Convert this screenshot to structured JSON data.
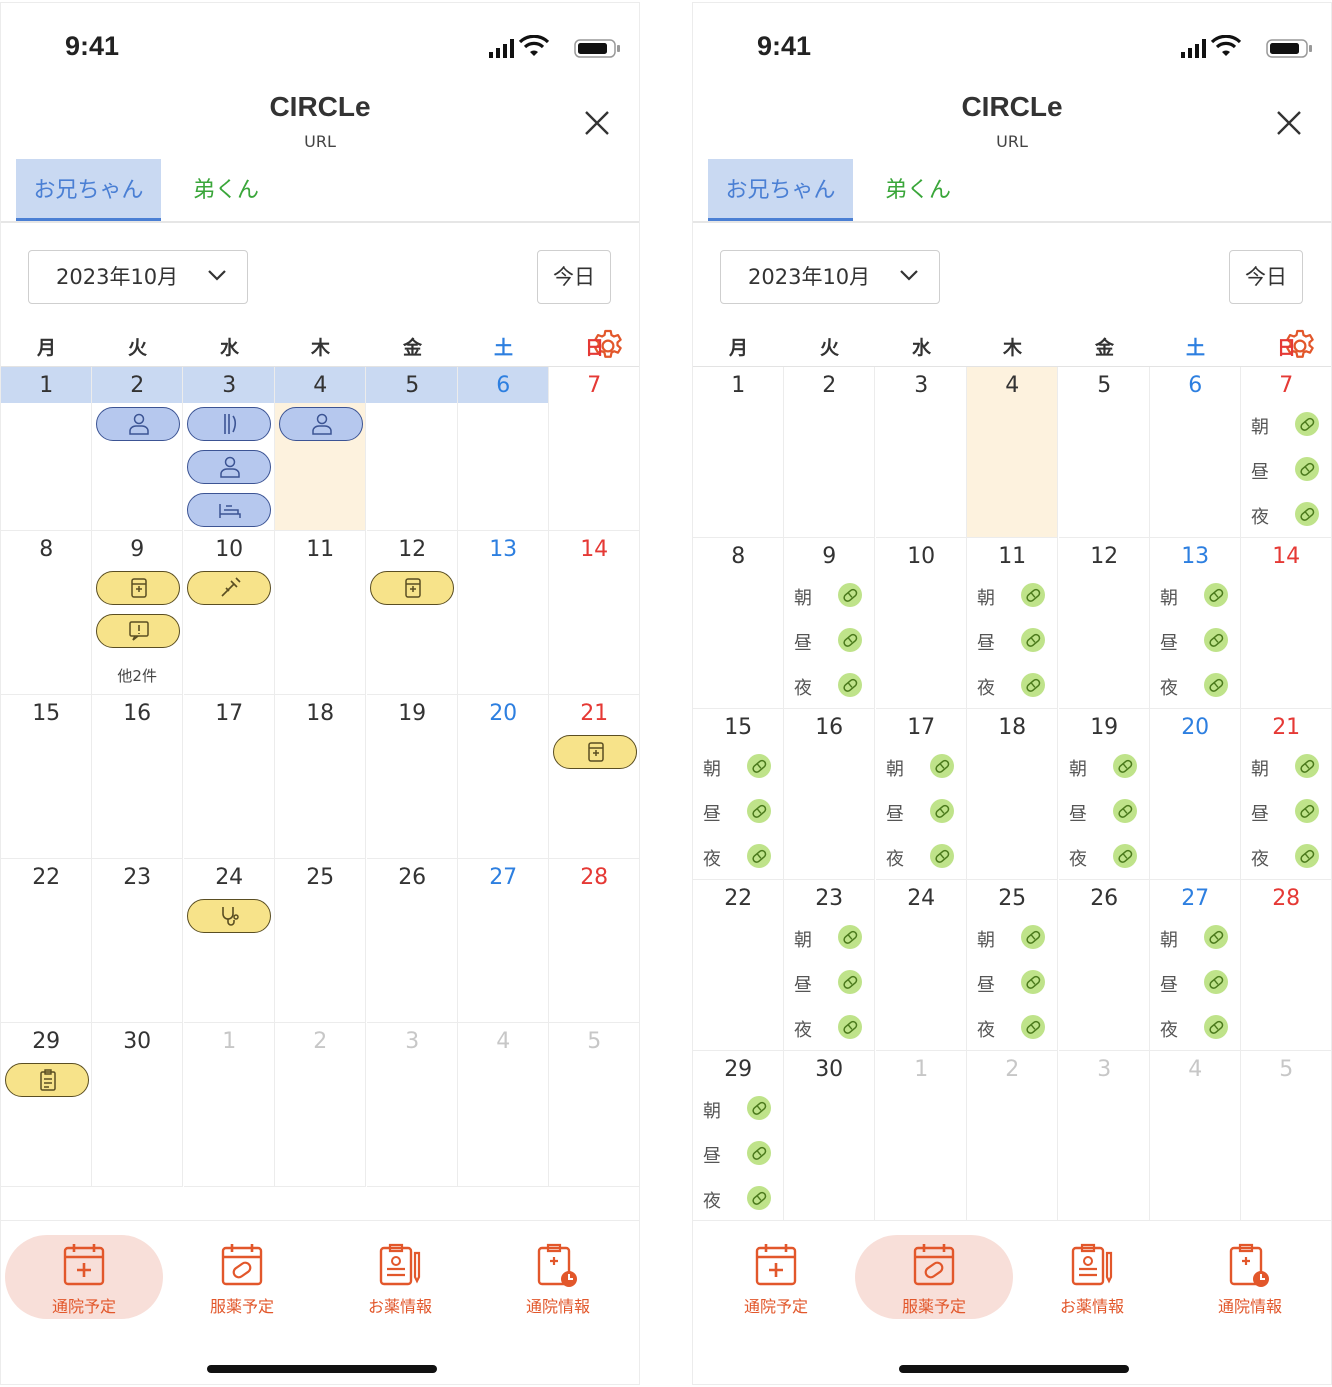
{
  "status": {
    "time": "9:41"
  },
  "app": {
    "title": "CIRCLe",
    "subtitle": "URL"
  },
  "tabs": [
    {
      "label": "お兄ちゃん"
    },
    {
      "label": "弟くん"
    }
  ],
  "month": {
    "label": "2023年10月"
  },
  "today_label": "今日",
  "weekdays": [
    "月",
    "火",
    "水",
    "木",
    "金",
    "土",
    "日"
  ],
  "weeks": [
    [
      "1",
      "2",
      "3",
      "4",
      "5",
      "6",
      "7"
    ],
    [
      "8",
      "9",
      "10",
      "11",
      "12",
      "13",
      "14"
    ],
    [
      "15",
      "16",
      "17",
      "18",
      "19",
      "20",
      "21"
    ],
    [
      "22",
      "23",
      "24",
      "25",
      "26",
      "27",
      "28"
    ],
    [
      "29",
      "30",
      "1",
      "2",
      "3",
      "4",
      "5"
    ]
  ],
  "more_label": "他2件",
  "med_times": [
    "朝",
    "昼",
    "夜"
  ],
  "nav": [
    {
      "label": "通院予定",
      "icon": "calendar-plus-icon"
    },
    {
      "label": "服薬予定",
      "icon": "calendar-pill-icon"
    },
    {
      "label": "お薬情報",
      "icon": "clipboard-pen-icon"
    },
    {
      "label": "通院情報",
      "icon": "clipboard-clock-icon"
    }
  ],
  "colors": {
    "accent_orange": "#e2572b",
    "tab_blue": "#4a7fd4",
    "tab_green": "#3aa63a",
    "saturday": "#2d7fe0",
    "sunday": "#e53935",
    "highlight_blue": "#c9d9f2",
    "today_cream": "#fdf2de",
    "pill_blue": "#b6c8ee",
    "pill_yellow": "#f7e38a",
    "med_green": "#bfe38a"
  }
}
